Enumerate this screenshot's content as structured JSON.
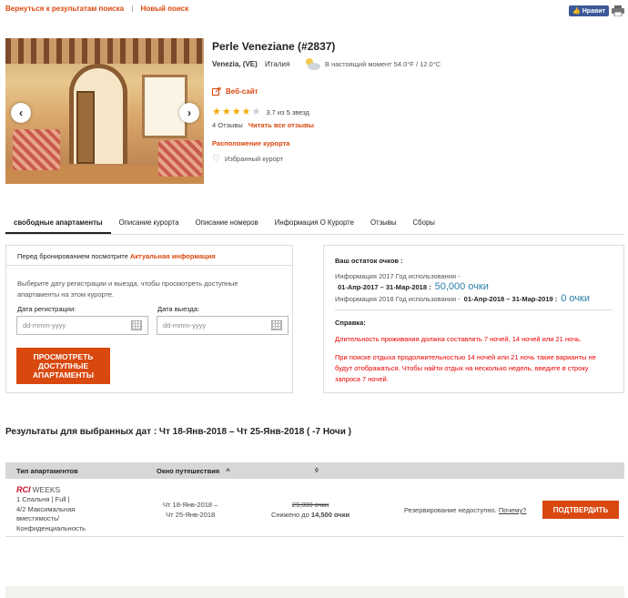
{
  "topnav": {
    "back_label": "Вернуться к результатам поиска",
    "separator": "|",
    "new_search_label": "Новый поиск"
  },
  "share": {
    "fb_label": "Нравит"
  },
  "carousel": {
    "prev_icon": "‹",
    "next_icon": "›"
  },
  "resort": {
    "title": "Perle Veneziane (#2837)",
    "city": "Venezia, (VE)",
    "country": "Италия",
    "weather": "В настоящий момент 54.0°F / 12.0°C",
    "website_label": "Веб-сайт",
    "rating_text": "3.7 из 5 звезд",
    "rating_value": 3.7,
    "reviews_count": "4 Отзывы",
    "read_reviews_label": "Читать все отзывы",
    "location_label": "Расположение курорта",
    "favorite_label": "Избранный курорт"
  },
  "tabs": [
    {
      "label": "свободные апартаменты",
      "active": true
    },
    {
      "label": "Описание курорта",
      "active": false
    },
    {
      "label": "Описание номеров",
      "active": false
    },
    {
      "label": "Информация О Курорте",
      "active": false
    },
    {
      "label": "Отзывы",
      "active": false
    },
    {
      "label": "Сборы",
      "active": false
    }
  ],
  "booking": {
    "header_prefix": "Перед бронированием посмотрите",
    "header_link": "Актуальная информация",
    "description": "Выберите дату регистрации и выезда, чтобы просмотреть доступные апартаменты на этом курорте.",
    "checkin_label": "Дата регистрации:",
    "checkin_placeholder": "dd-mmm-yyyy",
    "checkout_label": "Дата выезда:",
    "checkout_placeholder": "dd-mmm-yyyy",
    "search_button_line1": "ПРОСМОТРЕТЬ",
    "search_button_line2": "ДОСТУПНЫЕ",
    "search_button_line3": "АПАРТАМЕНТЫ"
  },
  "points": {
    "title": "Ваш остаток очков :",
    "line1_text": "Информация 2017 Год использования -",
    "line1_period": "01-Апр-2017 – 31-Мар-2018 :",
    "line1_value": "50,000 очки",
    "line2_text": "Информация 2018 Год использования -",
    "line2_period": "01-Апр-2018 – 31-Мар-2019 :",
    "line2_value": "0 очки",
    "help_title": "Справка:",
    "note1": "Длительность проживания должна составлять 7 ночей, 14 ночей или 21 ночь.",
    "note2_line1": "При поиске отдыха продолжительностью 14 ночей или 21 ночь такие варианты не",
    "note2_line2": "будут отображаться. Чтобы найти отдых на несколько недель, введите в строку",
    "note2_line3": "запроса 7 ночей."
  },
  "results": {
    "title": "Результаты для выбранных дат : Чт 18-Янв-2018 – Чт 25-Янв-2018   ( -7 Ночи )",
    "columns": {
      "type": "Тип апартаментов",
      "window": "Окно путешествия",
      "sort_up_icon": "^",
      "sort_both_icon": "◊"
    },
    "rows": [
      {
        "brand_logo": "RCI",
        "brand_name": "WEEKS",
        "unit_line1": "1 Спальня | Full |",
        "unit_line2": "4/2 Максимальная",
        "unit_line3": "вместимость/",
        "unit_line4": "Конфиденциальность",
        "date_from": "Чт 18-Янв-2018 –",
        "date_to": "Чт 25-Янв-2018",
        "old_price": "29,000 очки",
        "discount_prefix": "Снижено до",
        "new_price": "14,500 очки",
        "unavailable_text": "Резервирование недоступно.",
        "why_label": "Почему?",
        "confirm_label": "ПОДТВЕРДИТЬ"
      }
    ]
  },
  "colors": {
    "accent": "#d9480f",
    "points_blue": "#2a7fa8",
    "note_red": "#e00000",
    "header_gray": "#d7d7d7"
  }
}
